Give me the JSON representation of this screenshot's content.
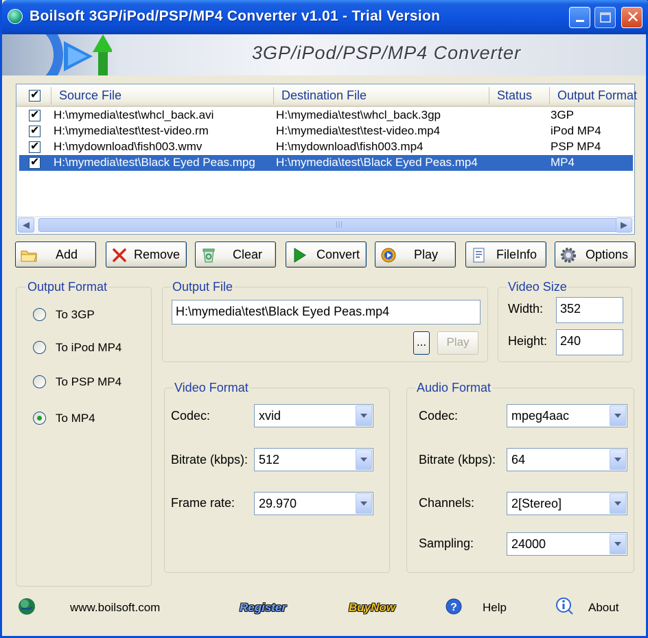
{
  "window": {
    "title": "Boilsoft 3GP/iPod/PSP/MP4 Converter v1.01 - Trial Version",
    "banner_title": "3GP/iPod/PSP/MP4  Converter"
  },
  "list": {
    "columns": [
      "Source File",
      "Destination File",
      "Status",
      "Output Format"
    ],
    "rows": [
      {
        "source": "H:\\mymedia\\test\\whcl_back.avi",
        "destination": "H:\\mymedia\\test\\whcl_back.3gp",
        "status": "",
        "format": "3GP",
        "checked": true,
        "selected": false
      },
      {
        "source": "H:\\mymedia\\test\\test-video.rm",
        "destination": "H:\\mymedia\\test\\test-video.mp4",
        "status": "",
        "format": "iPod MP4",
        "checked": true,
        "selected": false
      },
      {
        "source": "H:\\mydownload\\fish003.wmv",
        "destination": "H:\\mydownload\\fish003.mp4",
        "status": "",
        "format": "PSP MP4",
        "checked": true,
        "selected": false
      },
      {
        "source": "H:\\mymedia\\test\\Black Eyed Peas.mpg",
        "destination": "H:\\mymedia\\test\\Black Eyed Peas.mp4",
        "status": "",
        "format": "MP4",
        "checked": true,
        "selected": true
      }
    ]
  },
  "toolbar": {
    "add": "Add",
    "remove": "Remove",
    "clear": "Clear",
    "convert": "Convert",
    "play": "Play",
    "fileinfo": "FileInfo",
    "options": "Options"
  },
  "output_format": {
    "title": "Output Format",
    "options": [
      "To 3GP",
      "To iPod MP4",
      "To PSP MP4",
      "To MP4"
    ],
    "selected": "To MP4"
  },
  "output_file": {
    "title": "Output File",
    "value": "H:\\mymedia\\test\\Black Eyed Peas.mp4",
    "browse": "...",
    "play": "Play"
  },
  "video_size": {
    "title": "Video Size",
    "width_label": "Width:",
    "width": "352",
    "height_label": "Height:",
    "height": "240"
  },
  "video_format": {
    "title": "Video Format",
    "codec_label": "Codec:",
    "codec": "xvid",
    "bitrate_label": "Bitrate (kbps):",
    "bitrate": "512",
    "framerate_label": "Frame rate:",
    "framerate": "29.970"
  },
  "audio_format": {
    "title": "Audio Format",
    "codec_label": "Codec:",
    "codec": "mpeg4aac",
    "bitrate_label": "Bitrate (kbps):",
    "bitrate": "64",
    "channels_label": "Channels:",
    "channels": "2[Stereo]",
    "sampling_label": "Sampling:",
    "sampling": "24000"
  },
  "footer": {
    "website": "www.boilsoft.com",
    "register": "Register",
    "buynow": "BuyNow",
    "help": "Help",
    "about": "About"
  },
  "colors": {
    "title_bar": "#0a48c9",
    "selection": "#316ac5",
    "group_label": "#1f3ea8",
    "register": "#6fa3ff",
    "buynow": "#f2c020"
  }
}
